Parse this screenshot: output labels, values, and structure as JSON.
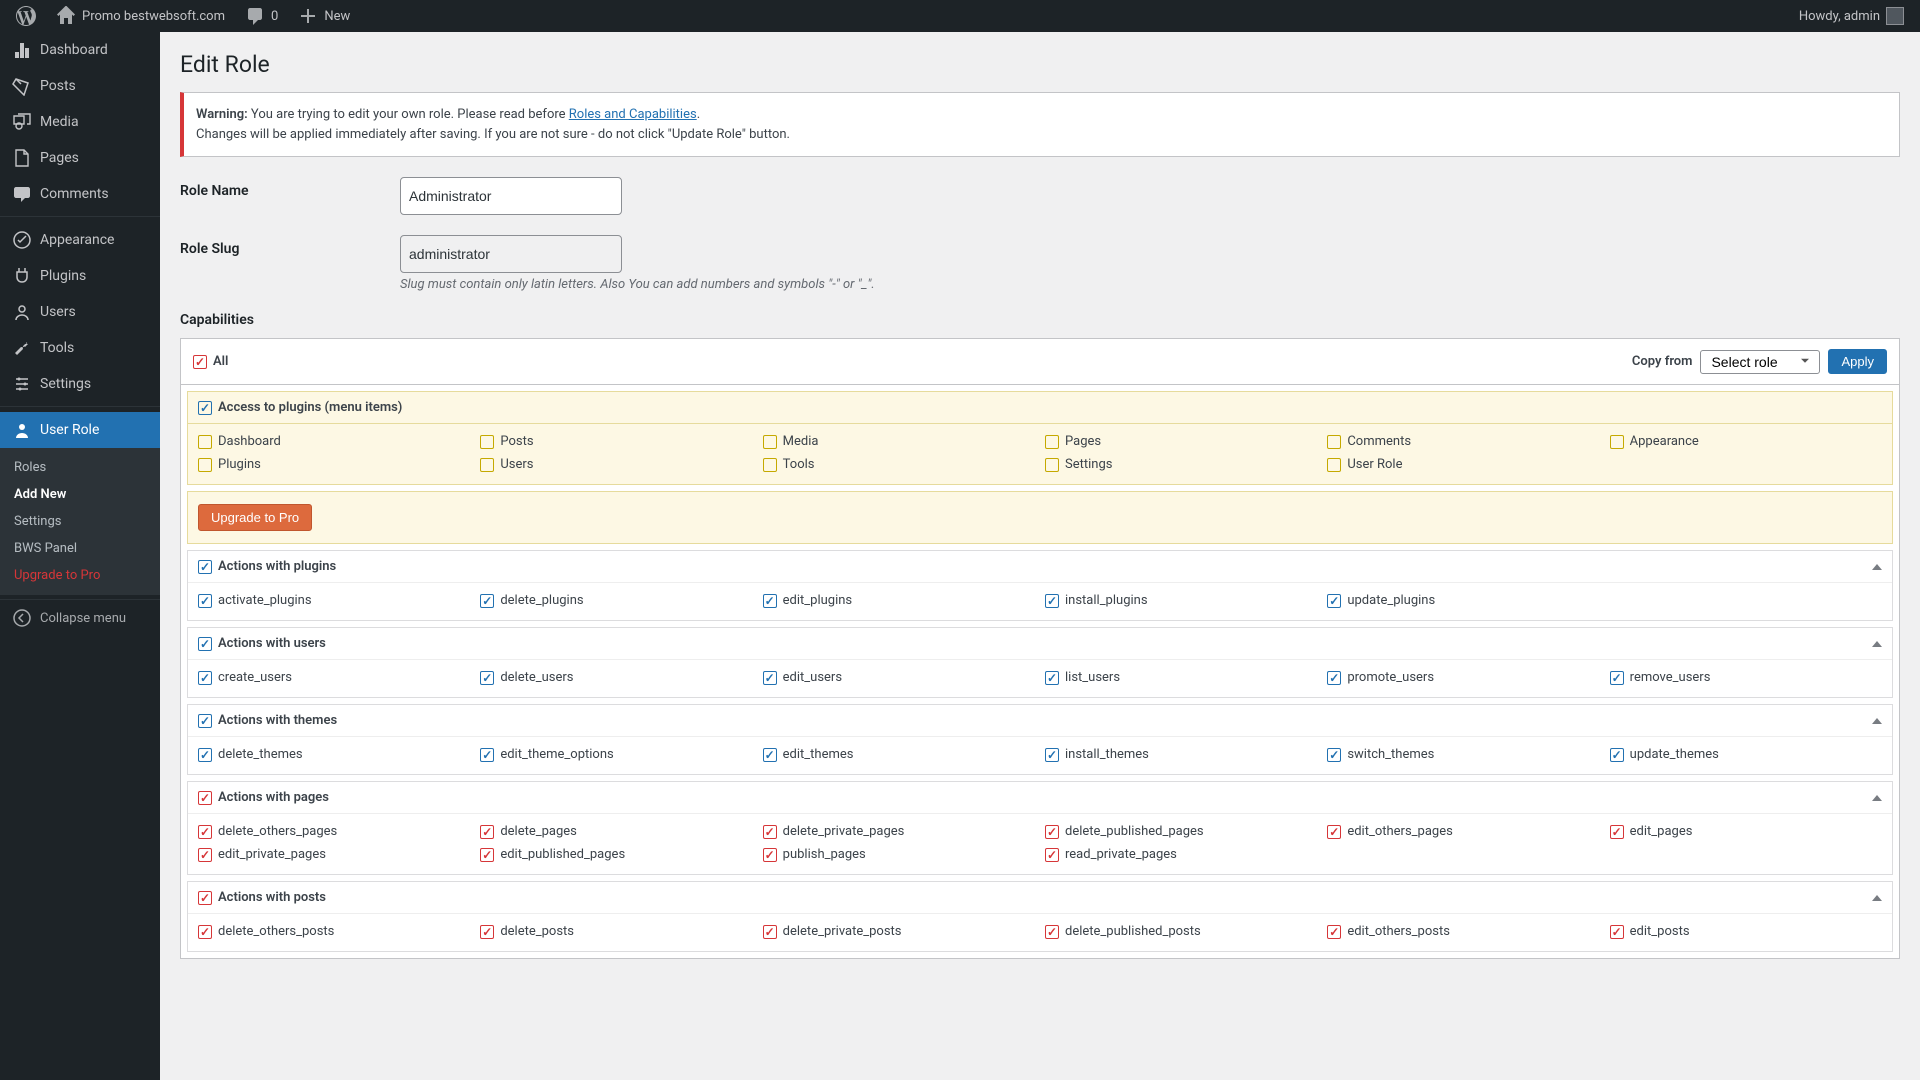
{
  "adminbar": {
    "site_name": "Promo bestwebsoft.com",
    "comments_count": "0",
    "new_label": "New",
    "howdy": "Howdy, admin"
  },
  "sidebar": {
    "items": [
      {
        "label": "Dashboard"
      },
      {
        "label": "Posts"
      },
      {
        "label": "Media"
      },
      {
        "label": "Pages"
      },
      {
        "label": "Comments"
      },
      {
        "label": "Appearance"
      },
      {
        "label": "Plugins"
      },
      {
        "label": "Users"
      },
      {
        "label": "Tools"
      },
      {
        "label": "Settings"
      },
      {
        "label": "User Role"
      }
    ],
    "submenu": [
      {
        "label": "Roles"
      },
      {
        "label": "Add New"
      },
      {
        "label": "Settings"
      },
      {
        "label": "BWS Panel"
      },
      {
        "label": "Upgrade to Pro"
      }
    ],
    "collapse": "Collapse menu"
  },
  "page": {
    "title": "Edit Role",
    "warning_label": "Warning:",
    "warning_text1": " You are trying to edit your own role. Please read before ",
    "warning_link": "Roles and Capabilities",
    "warning_text2": ".",
    "warning_line2": "Changes will be applied immediately after saving. If you are not sure - do not click \"Update Role\" button.",
    "role_name_label": "Role Name",
    "role_name_value": "Administrator",
    "role_slug_label": "Role Slug",
    "role_slug_value": "administrator",
    "slug_desc": "Slug must contain only latin letters. Also You can add numbers and symbols \"-\" or \"_\".",
    "capabilities_heading": "Capabilities",
    "all_label": "All",
    "copy_from_label": "Copy from",
    "select_role": "Select role",
    "apply": "Apply",
    "upgrade": "Upgrade to Pro"
  },
  "sections": [
    {
      "title": "Access to plugins (menu items)",
      "highlight": true,
      "head_check_style": "checked",
      "item_check_style": "empty-yellow",
      "items": [
        "Dashboard",
        "Posts",
        "Media",
        "Pages",
        "Comments",
        "Appearance",
        "Plugins",
        "Users",
        "Tools",
        "Settings",
        "User Role"
      ]
    },
    {
      "title": "Actions with plugins",
      "head_check_style": "checked",
      "item_check_style": "checked",
      "items": [
        "activate_plugins",
        "delete_plugins",
        "edit_plugins",
        "install_plugins",
        "update_plugins"
      ]
    },
    {
      "title": "Actions with users",
      "head_check_style": "checked",
      "item_check_style": "checked",
      "items": [
        "create_users",
        "delete_users",
        "edit_users",
        "list_users",
        "promote_users",
        "remove_users"
      ]
    },
    {
      "title": "Actions with themes",
      "head_check_style": "checked",
      "item_check_style": "checked",
      "items": [
        "delete_themes",
        "edit_theme_options",
        "edit_themes",
        "install_themes",
        "switch_themes",
        "update_themes"
      ]
    },
    {
      "title": "Actions with pages",
      "head_check_style": "checked-red",
      "item_check_style": "checked-red",
      "items": [
        "delete_others_pages",
        "delete_pages",
        "delete_private_pages",
        "delete_published_pages",
        "edit_others_pages",
        "edit_pages",
        "edit_private_pages",
        "edit_published_pages",
        "publish_pages",
        "read_private_pages"
      ]
    },
    {
      "title": "Actions with posts",
      "head_check_style": "checked-red",
      "item_check_style": "checked-red",
      "items": [
        "delete_others_posts",
        "delete_posts",
        "delete_private_posts",
        "delete_published_posts",
        "edit_others_posts",
        "edit_posts"
      ]
    }
  ]
}
